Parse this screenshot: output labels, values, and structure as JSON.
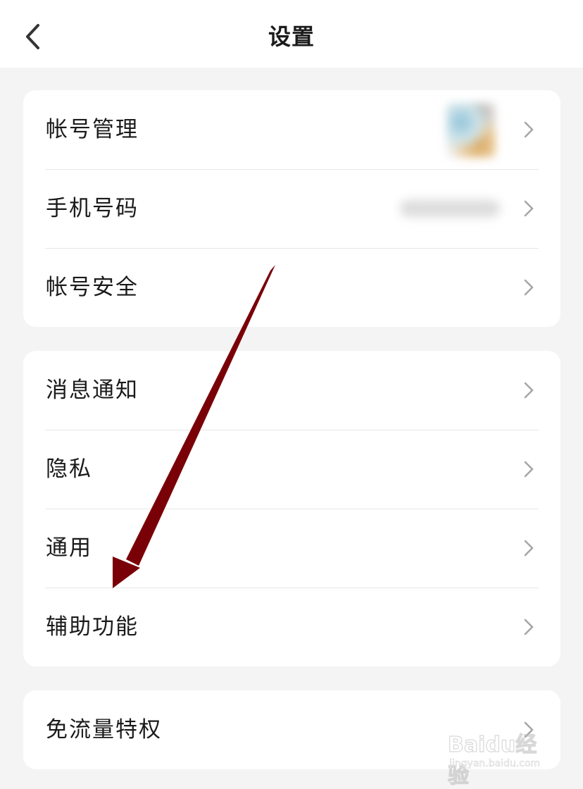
{
  "header": {
    "title": "设置"
  },
  "groups": [
    {
      "items": [
        {
          "label": "帐号管理",
          "value_kind": "avatar"
        },
        {
          "label": "手机号码",
          "value_kind": "phone"
        },
        {
          "label": "帐号安全"
        }
      ]
    },
    {
      "items": [
        {
          "label": "消息通知"
        },
        {
          "label": "隐私"
        },
        {
          "label": "通用"
        },
        {
          "label": "辅助功能"
        }
      ]
    },
    {
      "items": [
        {
          "label": "免流量特权"
        }
      ]
    }
  ],
  "annotation": {
    "arrow_color": "#7a0008",
    "target_item": "辅助功能"
  },
  "watermark": {
    "brand": "Baidu经验",
    "url": "jingyan.baidu.com"
  },
  "colors": {
    "background": "#f4f4f4",
    "card": "#ffffff",
    "divider": "#e7e7e7",
    "chevron": "#a6a6a6"
  }
}
